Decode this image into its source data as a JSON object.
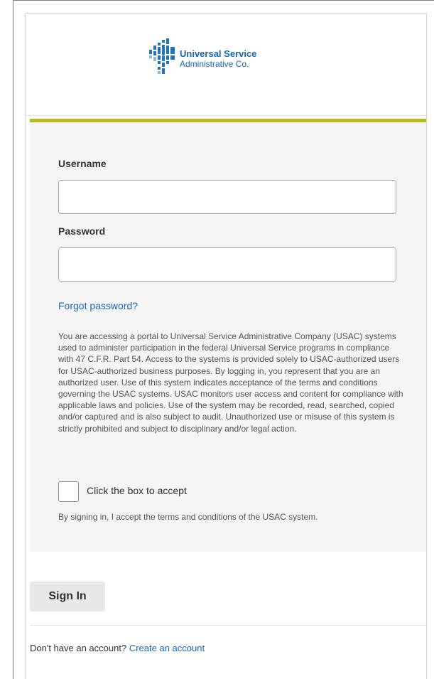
{
  "logo": {
    "line1": "Universal Service",
    "line2": "Administrative Co."
  },
  "colors": {
    "accent_bar": "#b5bb1a",
    "link": "#1766c0",
    "logo_blue": "#1766b5"
  },
  "form": {
    "username_label": "Username",
    "username_value": "",
    "password_label": "Password",
    "password_value": "",
    "forgot_password": "Forgot password?",
    "legal_text": "You are accessing a portal to Universal Service Administrative Company (USAC) systems used to administer participation in the federal Universal Service programs in compliance with 47 C.F.R. Part 54. Access to the systems is provided solely to USAC-authorized users for USAC-authorized business purposes. By logging in, you represent that you are an authorized user. Use of this system indicates acceptance of the terms and conditions governing the USAC systems. USAC monitors user access and content for compliance with applicable laws and policies. Use of the system may be recorded, read, searched, copied and/or captured and is also subject to audit. Unauthorized use or misuse of this system is strictly prohibited and subject to disciplinary and/or legal action.",
    "accept_checkbox_label": "Click the box to accept",
    "accept_checked": false,
    "terms_note": "By signing in, I accept the terms and conditions of the USAC system."
  },
  "actions": {
    "sign_in": "Sign In"
  },
  "footer": {
    "prompt": "Don't have an account?",
    "create_account": "Create an account"
  }
}
